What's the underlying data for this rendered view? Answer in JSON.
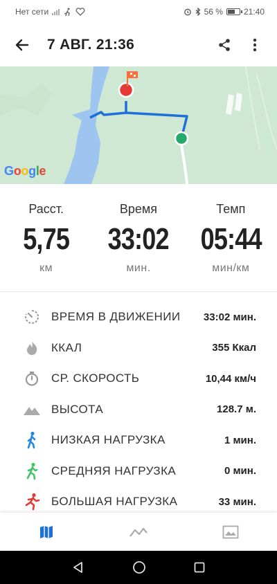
{
  "status_bar": {
    "network_text": "Нет сети",
    "battery_percent": "56 %",
    "battery_level": 0.56,
    "time": "21:40"
  },
  "app_bar": {
    "title": "7 АВГ. 21:36",
    "back_icon": "arrow-back-icon",
    "share_icon": "share-icon",
    "menu_icon": "more-vert-icon"
  },
  "map": {
    "attribution": [
      "G",
      "o",
      "o",
      "g",
      "l",
      "e"
    ],
    "route_color": "#1e6fd9",
    "start_color": "#26a96c",
    "finish_color": "#e53935"
  },
  "summary": {
    "distance": {
      "label": "Расст.",
      "value": "5,75",
      "unit": "км"
    },
    "time": {
      "label": "Время",
      "value": "33:02",
      "unit": "мин."
    },
    "pace": {
      "label": "Темп",
      "value": "05:44",
      "unit": "мин/км"
    }
  },
  "details": [
    {
      "icon": "timer-moving-icon",
      "label": "ВРЕМЯ В ДВИЖЕНИИ",
      "value": "33:02 мин."
    },
    {
      "icon": "flame-icon",
      "label": "ККАЛ",
      "value": "355 Ккал"
    },
    {
      "icon": "stopwatch-icon",
      "label": "СР. СКОРОСТЬ",
      "value": "10,44 км/ч"
    },
    {
      "icon": "mountain-icon",
      "label": "ВЫСОТА",
      "value": "128.7 м."
    },
    {
      "icon": "walker-icon",
      "label": "НИЗКАЯ НАГРУЗКА",
      "value": "1 мин.",
      "color": "#1e88e5"
    },
    {
      "icon": "jogger-icon",
      "label": "СРЕДНЯЯ НАГРУЗКА",
      "value": "0 мин.",
      "color": "#43c46a"
    },
    {
      "icon": "runner-icon",
      "label": "БОЛЬШАЯ НАГРУЗКА",
      "value": "33 мин.",
      "color": "#e53935"
    }
  ],
  "bottom_nav": [
    {
      "icon": "map-icon",
      "active": true
    },
    {
      "icon": "chart-icon",
      "active": false
    },
    {
      "icon": "photo-icon",
      "active": false
    }
  ]
}
